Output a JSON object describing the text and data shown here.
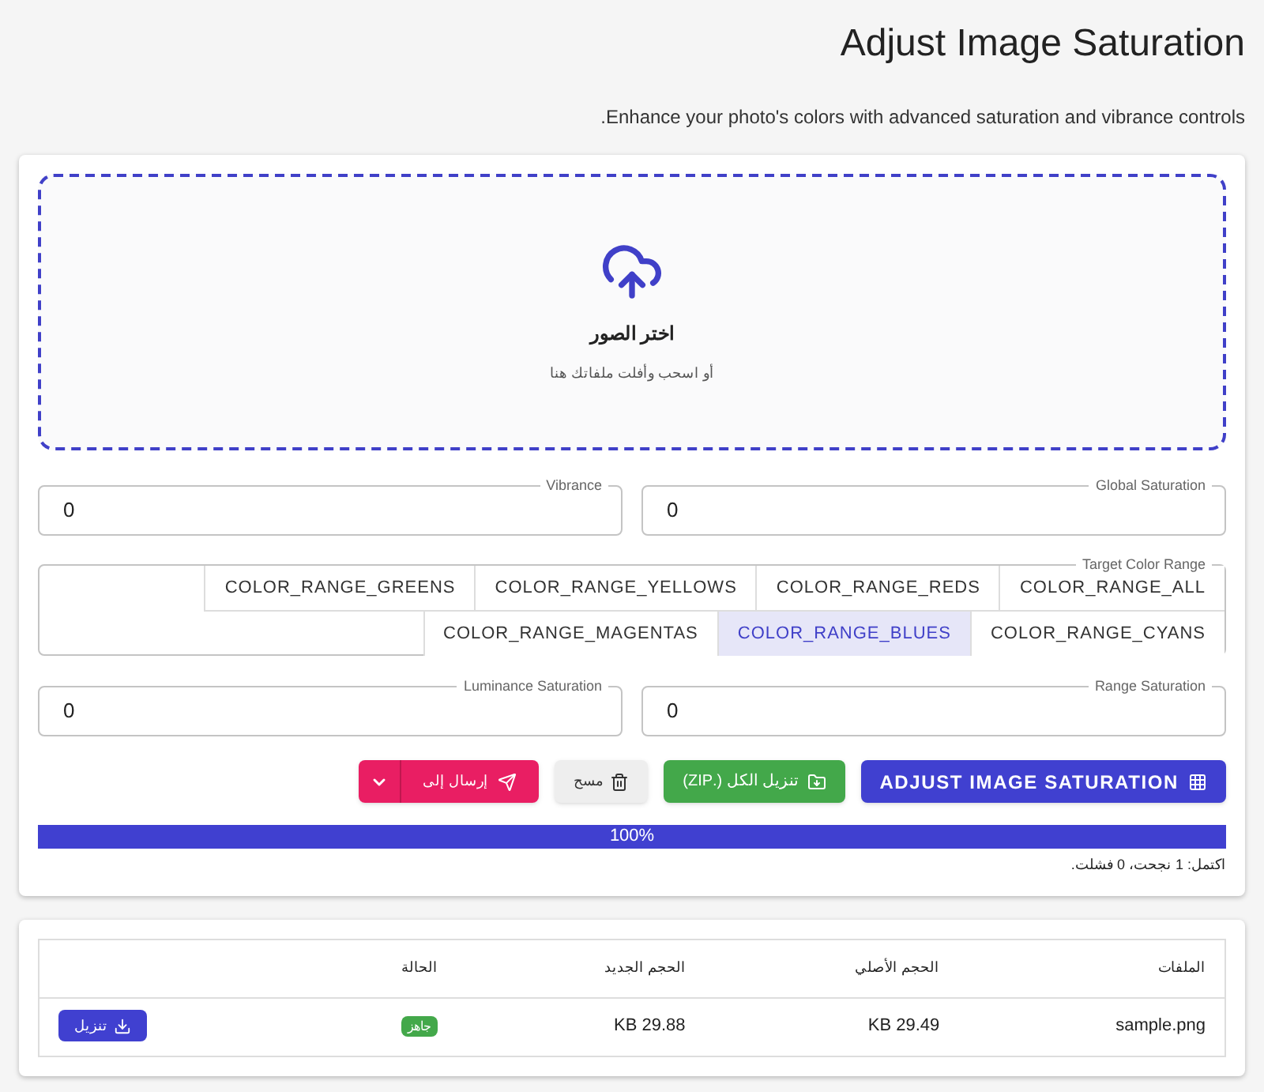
{
  "page": {
    "title": "Adjust Image Saturation",
    "subtitle": "Enhance your photo's colors with advanced saturation and vibrance controls."
  },
  "dropzone": {
    "title": "اختر الصور",
    "hint": "أو اسحب وأفلت ملفاتك هنا"
  },
  "fields_top": [
    {
      "label": "Global Saturation",
      "value": "0"
    },
    {
      "label": "Vibrance",
      "value": "0"
    }
  ],
  "color_range": {
    "label": "Target Color Range",
    "options": [
      {
        "label": "COLOR_RANGE_ALL",
        "selected": false
      },
      {
        "label": "COLOR_RANGE_REDS",
        "selected": false
      },
      {
        "label": "COLOR_RANGE_YELLOWS",
        "selected": false
      },
      {
        "label": "COLOR_RANGE_GREENS",
        "selected": false
      },
      {
        "label": "COLOR_RANGE_CYANS",
        "selected": false
      },
      {
        "label": "COLOR_RANGE_BLUES",
        "selected": true
      },
      {
        "label": "COLOR_RANGE_MAGENTAS",
        "selected": false
      }
    ]
  },
  "fields_bottom": [
    {
      "label": "Range Saturation",
      "value": "0"
    },
    {
      "label": "Luminance Saturation",
      "value": "0"
    }
  ],
  "actions": {
    "adjust": "ADJUST IMAGE SATURATION",
    "download_all": "تنزيل الكل (.ZIP)",
    "clear": "مسح",
    "send_to": "إرسال إلى"
  },
  "progress": {
    "level": 1,
    "reading": "100%",
    "status": "اكتمل: 1 نجحت، 0 فشلت."
  },
  "table": {
    "columns": [
      "الملفات",
      "الحجم الأصلي",
      "الحجم الجديد",
      "الحالة"
    ],
    "rows": [
      {
        "file": "sample.png",
        "original": "29.49 KB",
        "new": "29.88 KB",
        "status": "جاهز",
        "action": "تنزيل"
      }
    ]
  }
}
